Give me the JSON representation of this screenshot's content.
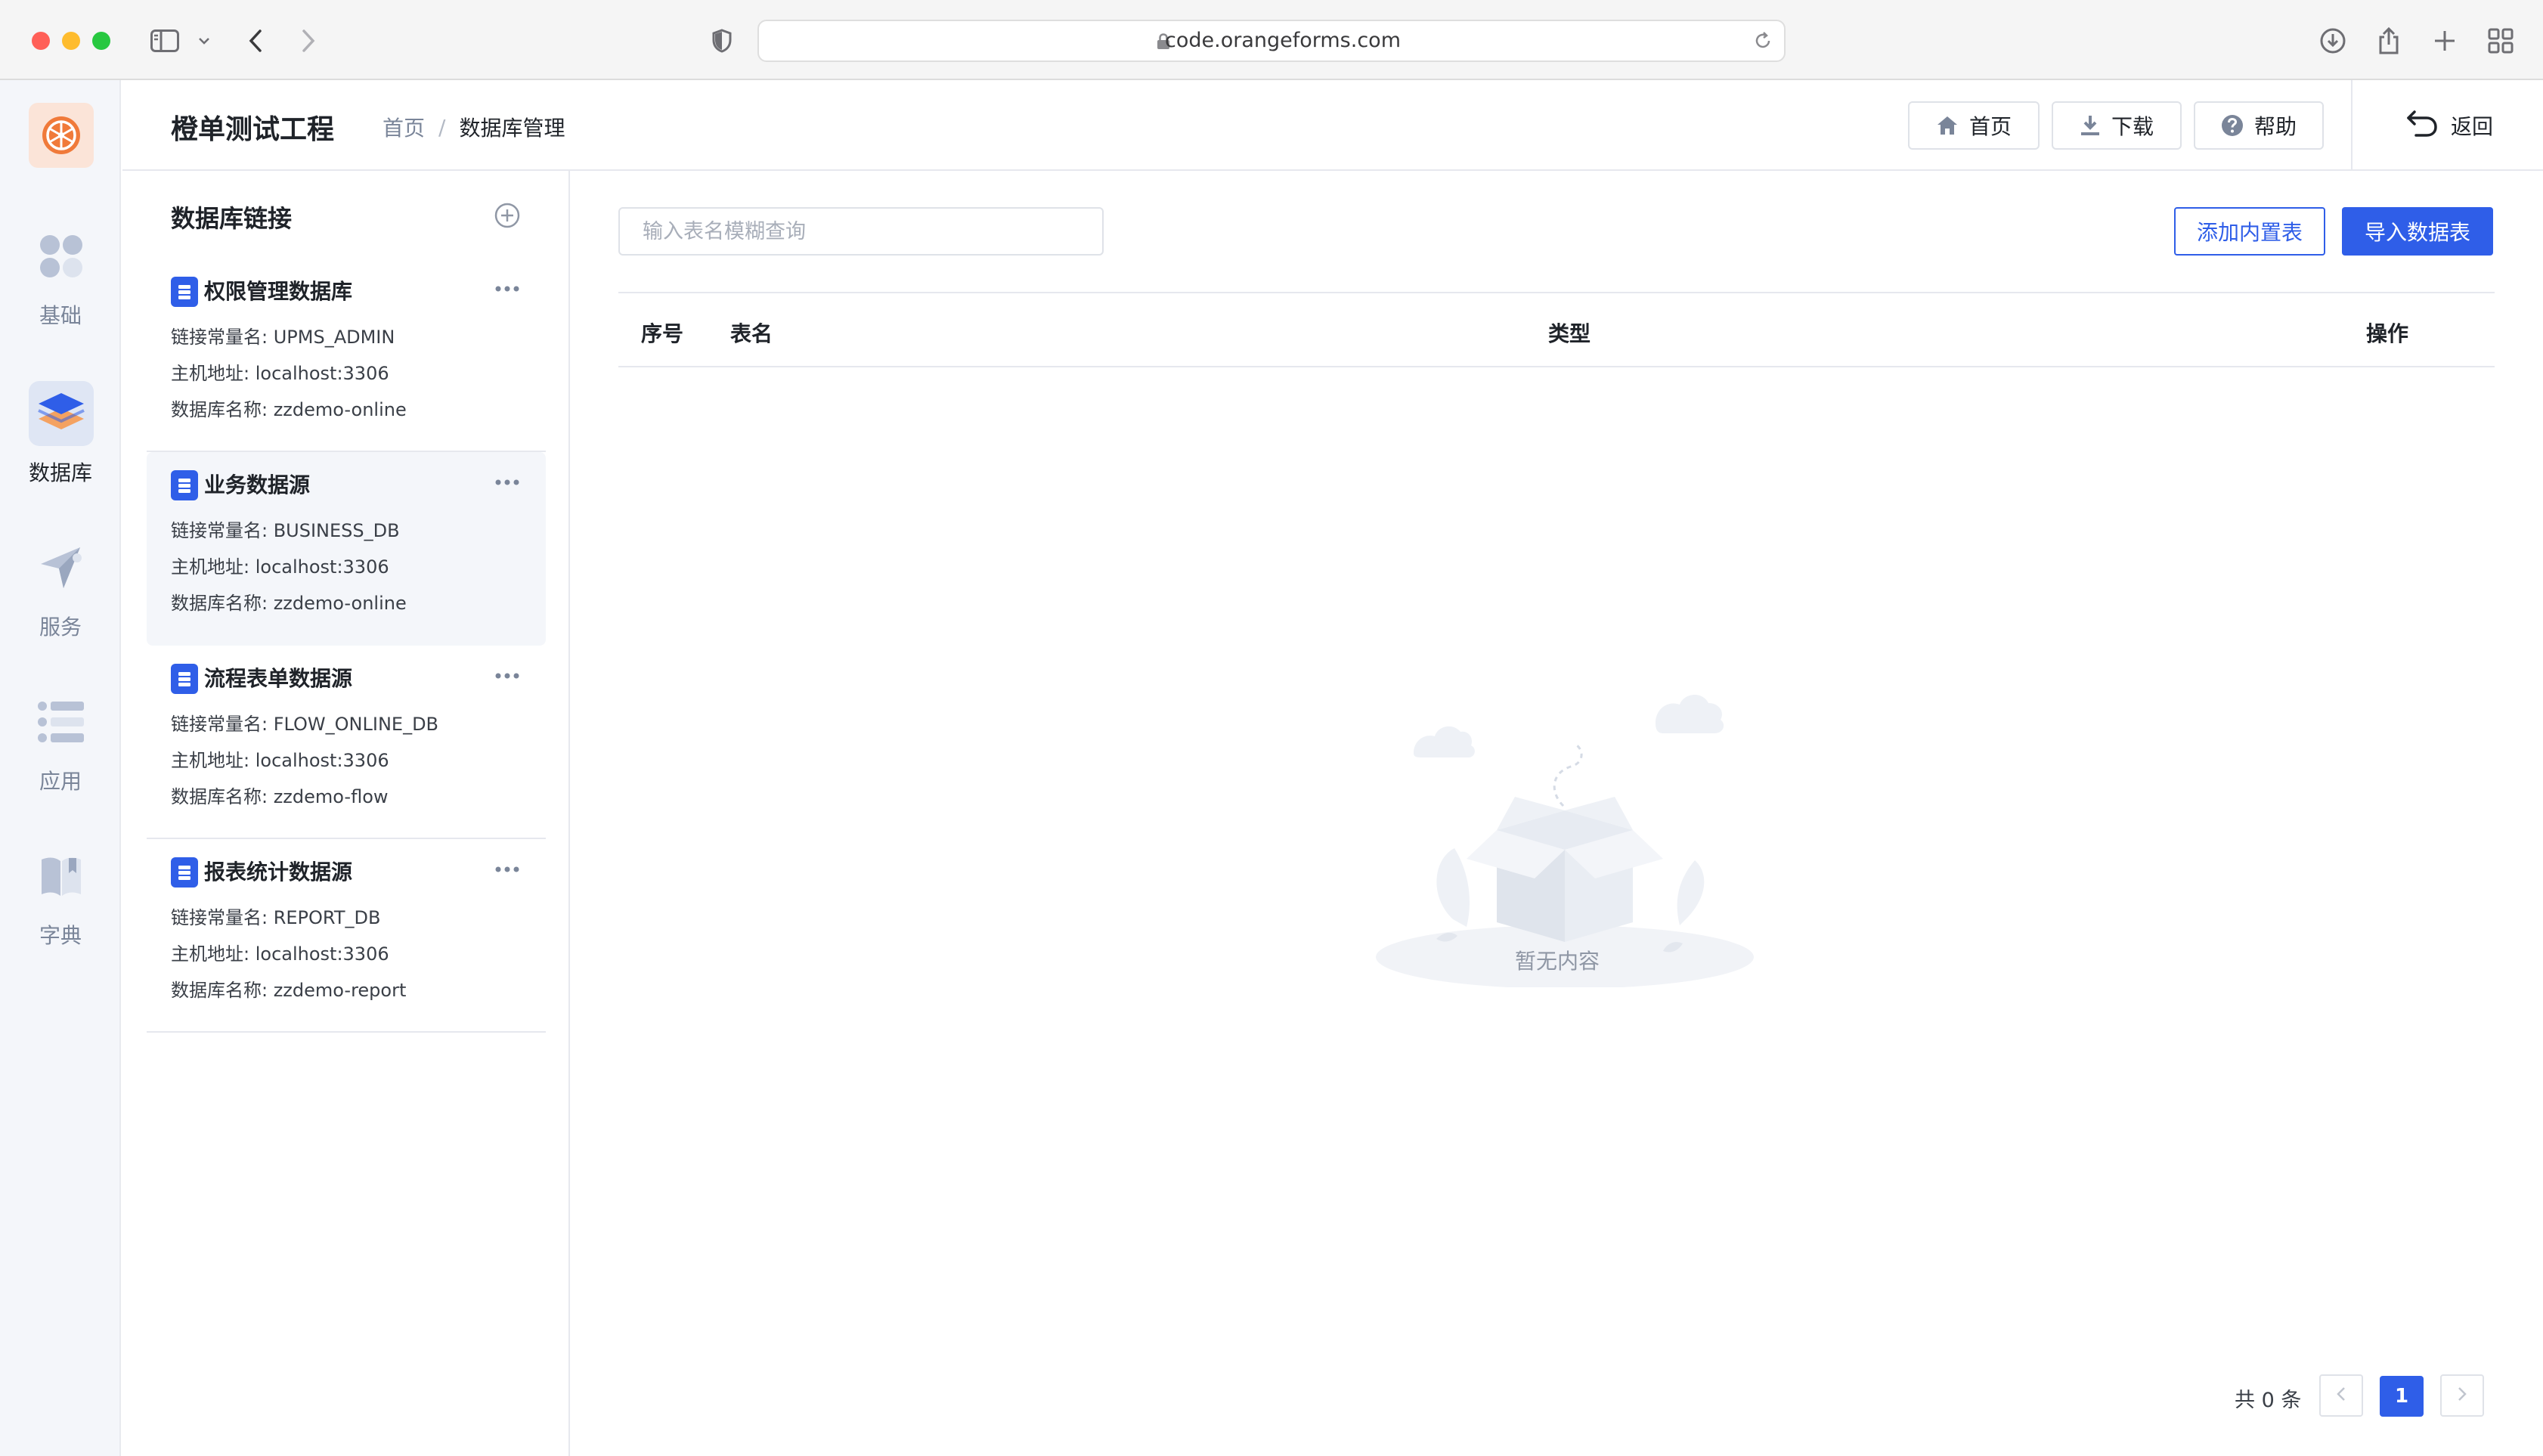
{
  "browser": {
    "url": "code.orangeforms.com"
  },
  "rail": {
    "items": [
      {
        "label": "基础",
        "icon": "grid-icon",
        "active": false
      },
      {
        "label": "数据库",
        "icon": "layers-icon",
        "active": true
      },
      {
        "label": "服务",
        "icon": "send-icon",
        "active": false
      },
      {
        "label": "应用",
        "icon": "list-icon",
        "active": false
      },
      {
        "label": "字典",
        "icon": "book-icon",
        "active": false
      }
    ]
  },
  "header": {
    "title": "橙单测试工程",
    "breadcrumb": {
      "home": "首页",
      "separator": "/",
      "current": "数据库管理"
    },
    "buttons": {
      "home": "首页",
      "download": "下载",
      "help": "帮助"
    },
    "back": "返回"
  },
  "db_panel": {
    "title": "数据库链接",
    "items": [
      {
        "name": "权限管理数据库",
        "const_name": "链接常量名: UPMS_ADMIN",
        "host": "主机地址: localhost:3306",
        "db_name": "数据库名称:  zzdemo-online",
        "selected": false
      },
      {
        "name": "业务数据源",
        "const_name": "链接常量名: BUSINESS_DB",
        "host": "主机地址: localhost:3306",
        "db_name": "数据库名称:  zzdemo-online",
        "selected": true
      },
      {
        "name": "流程表单数据源",
        "const_name": "链接常量名: FLOW_ONLINE_DB",
        "host": "主机地址: localhost:3306",
        "db_name": "数据库名称:  zzdemo-flow",
        "selected": false
      },
      {
        "name": "报表统计数据源",
        "const_name": "链接常量名: REPORT_DB",
        "host": "主机地址: localhost:3306",
        "db_name": "数据库名称:  zzdemo-report",
        "selected": false
      }
    ]
  },
  "main": {
    "search": {
      "placeholder": "输入表名模糊查询",
      "value": ""
    },
    "buttons": {
      "add_builtin": "添加内置表",
      "import": "导入数据表"
    },
    "table": {
      "columns": [
        "序号",
        "表名",
        "类型",
        "操作"
      ],
      "rows": []
    },
    "empty_text": "暂无内容",
    "pagination": {
      "total": "共 0 条",
      "current_page": "1"
    }
  },
  "colors": {
    "primary": "#2f5ee8",
    "brand_orange": "#f07a3a",
    "rail_bg": "#f4f6fa"
  }
}
